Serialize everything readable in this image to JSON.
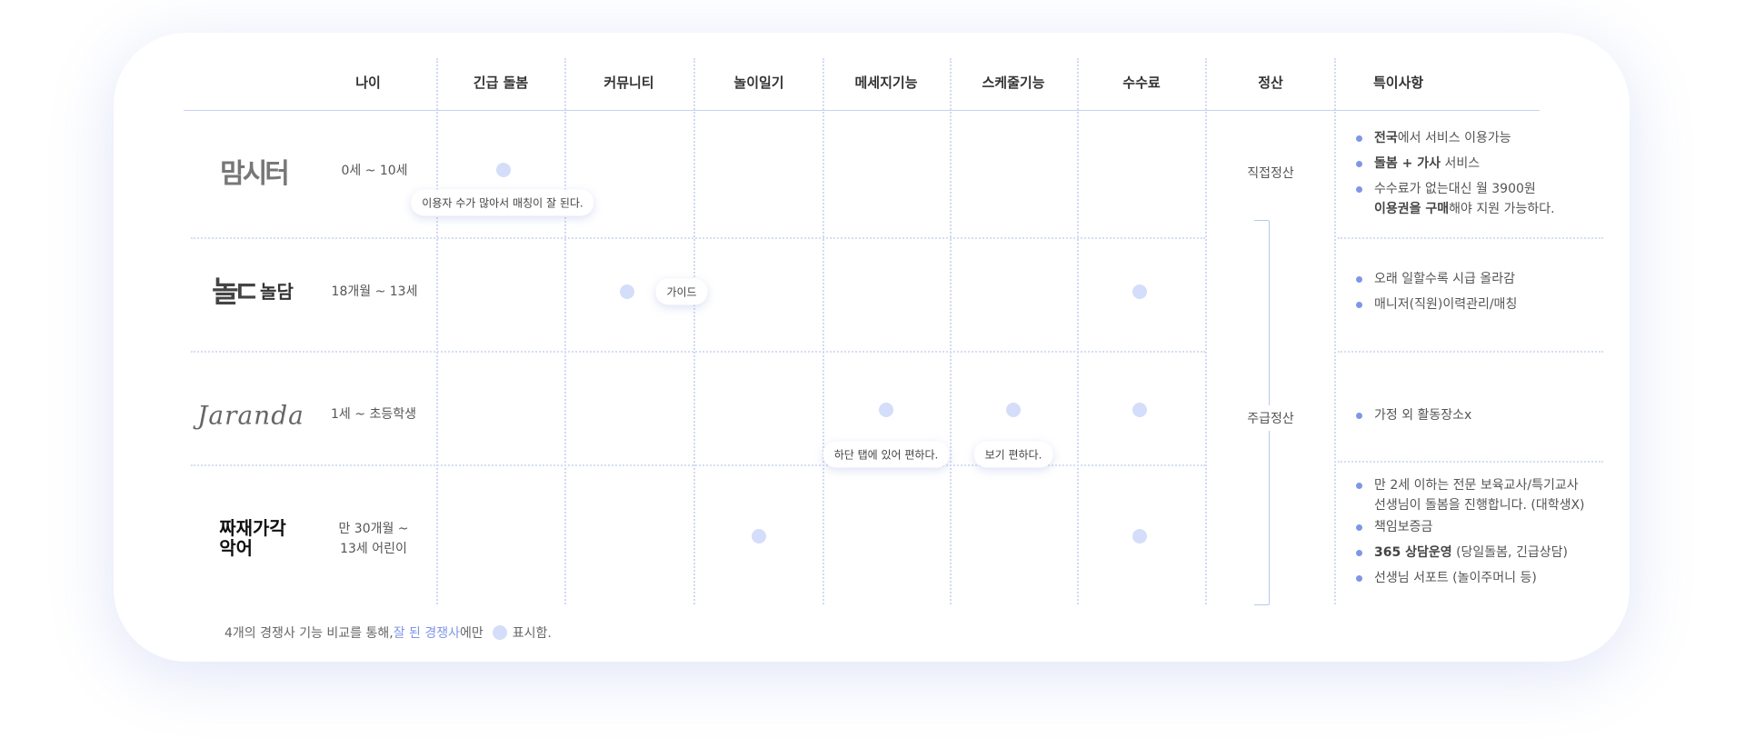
{
  "headers": {
    "age": "나이",
    "emergency": "긴급 돌봄",
    "community": "커뮤니티",
    "diary": "놀이일기",
    "message": "메세지기능",
    "schedule": "스케줄기능",
    "fee": "수수료",
    "settlement": "정산",
    "notes": "특이사항"
  },
  "rows": [
    {
      "logo": "맘시터",
      "age": "0세 ~ 10세",
      "tooltip_emergency": "이용자 수가 많아서 매칭이 잘 된다.",
      "notes": [
        {
          "bold": "전국",
          "text": "에서 서비스 이용가능"
        },
        {
          "bold": "돌봄 + 가사",
          "text": " 서비스"
        },
        {
          "bold": "",
          "text": "수수료가 없는대신 월 3900원"
        },
        {
          "bold": "이용권을 구매",
          "text": "해야 지원 가능하다."
        }
      ]
    },
    {
      "logo_mark": "놀ㄷ",
      "logo": "놀담",
      "age": "18개월 ~ 13세",
      "tooltip_community": "가이드",
      "notes": [
        {
          "text": "오래 일할수록 시급 올라감"
        },
        {
          "text": "매니저(직원)이력관리/매칭"
        }
      ]
    },
    {
      "logo": "Jaranda",
      "age": "1세 ~ 초등학생",
      "tooltip_message": "하단 탭에 있어 편하다.",
      "tooltip_schedule": "보기 편하다.",
      "notes": [
        {
          "text": "가정 외 활동장소x"
        }
      ]
    },
    {
      "logo_line1": "짜재가각",
      "logo_line2": "악어",
      "age_line1": "만 30개월 ~",
      "age_line2": "13세 어린이",
      "notes": [
        {
          "text": "만 2세 이하는 전문 보육교사/특기교사"
        },
        {
          "text": "선생님이 돌봄을 진행합니다. (대학생X)"
        },
        {
          "text": "책임보증금"
        },
        {
          "bold": "365 상담운영",
          "text": " (당일돌봄, 긴급상담)"
        },
        {
          "text": "선생님 서포트 (놀이주머니 등)"
        }
      ]
    }
  ],
  "settlement": {
    "direct": "직접정산",
    "weekly": "주급정산"
  },
  "footer": {
    "prefix": "4개의 경쟁사 기능 비교를 통해, ",
    "highlight": "잘 된 경쟁사",
    "middle": "에만",
    "suffix": "표시함."
  },
  "colors": {
    "accent": "#7d96e8",
    "dot": "#d4defa",
    "line": "#c7d3f1"
  }
}
